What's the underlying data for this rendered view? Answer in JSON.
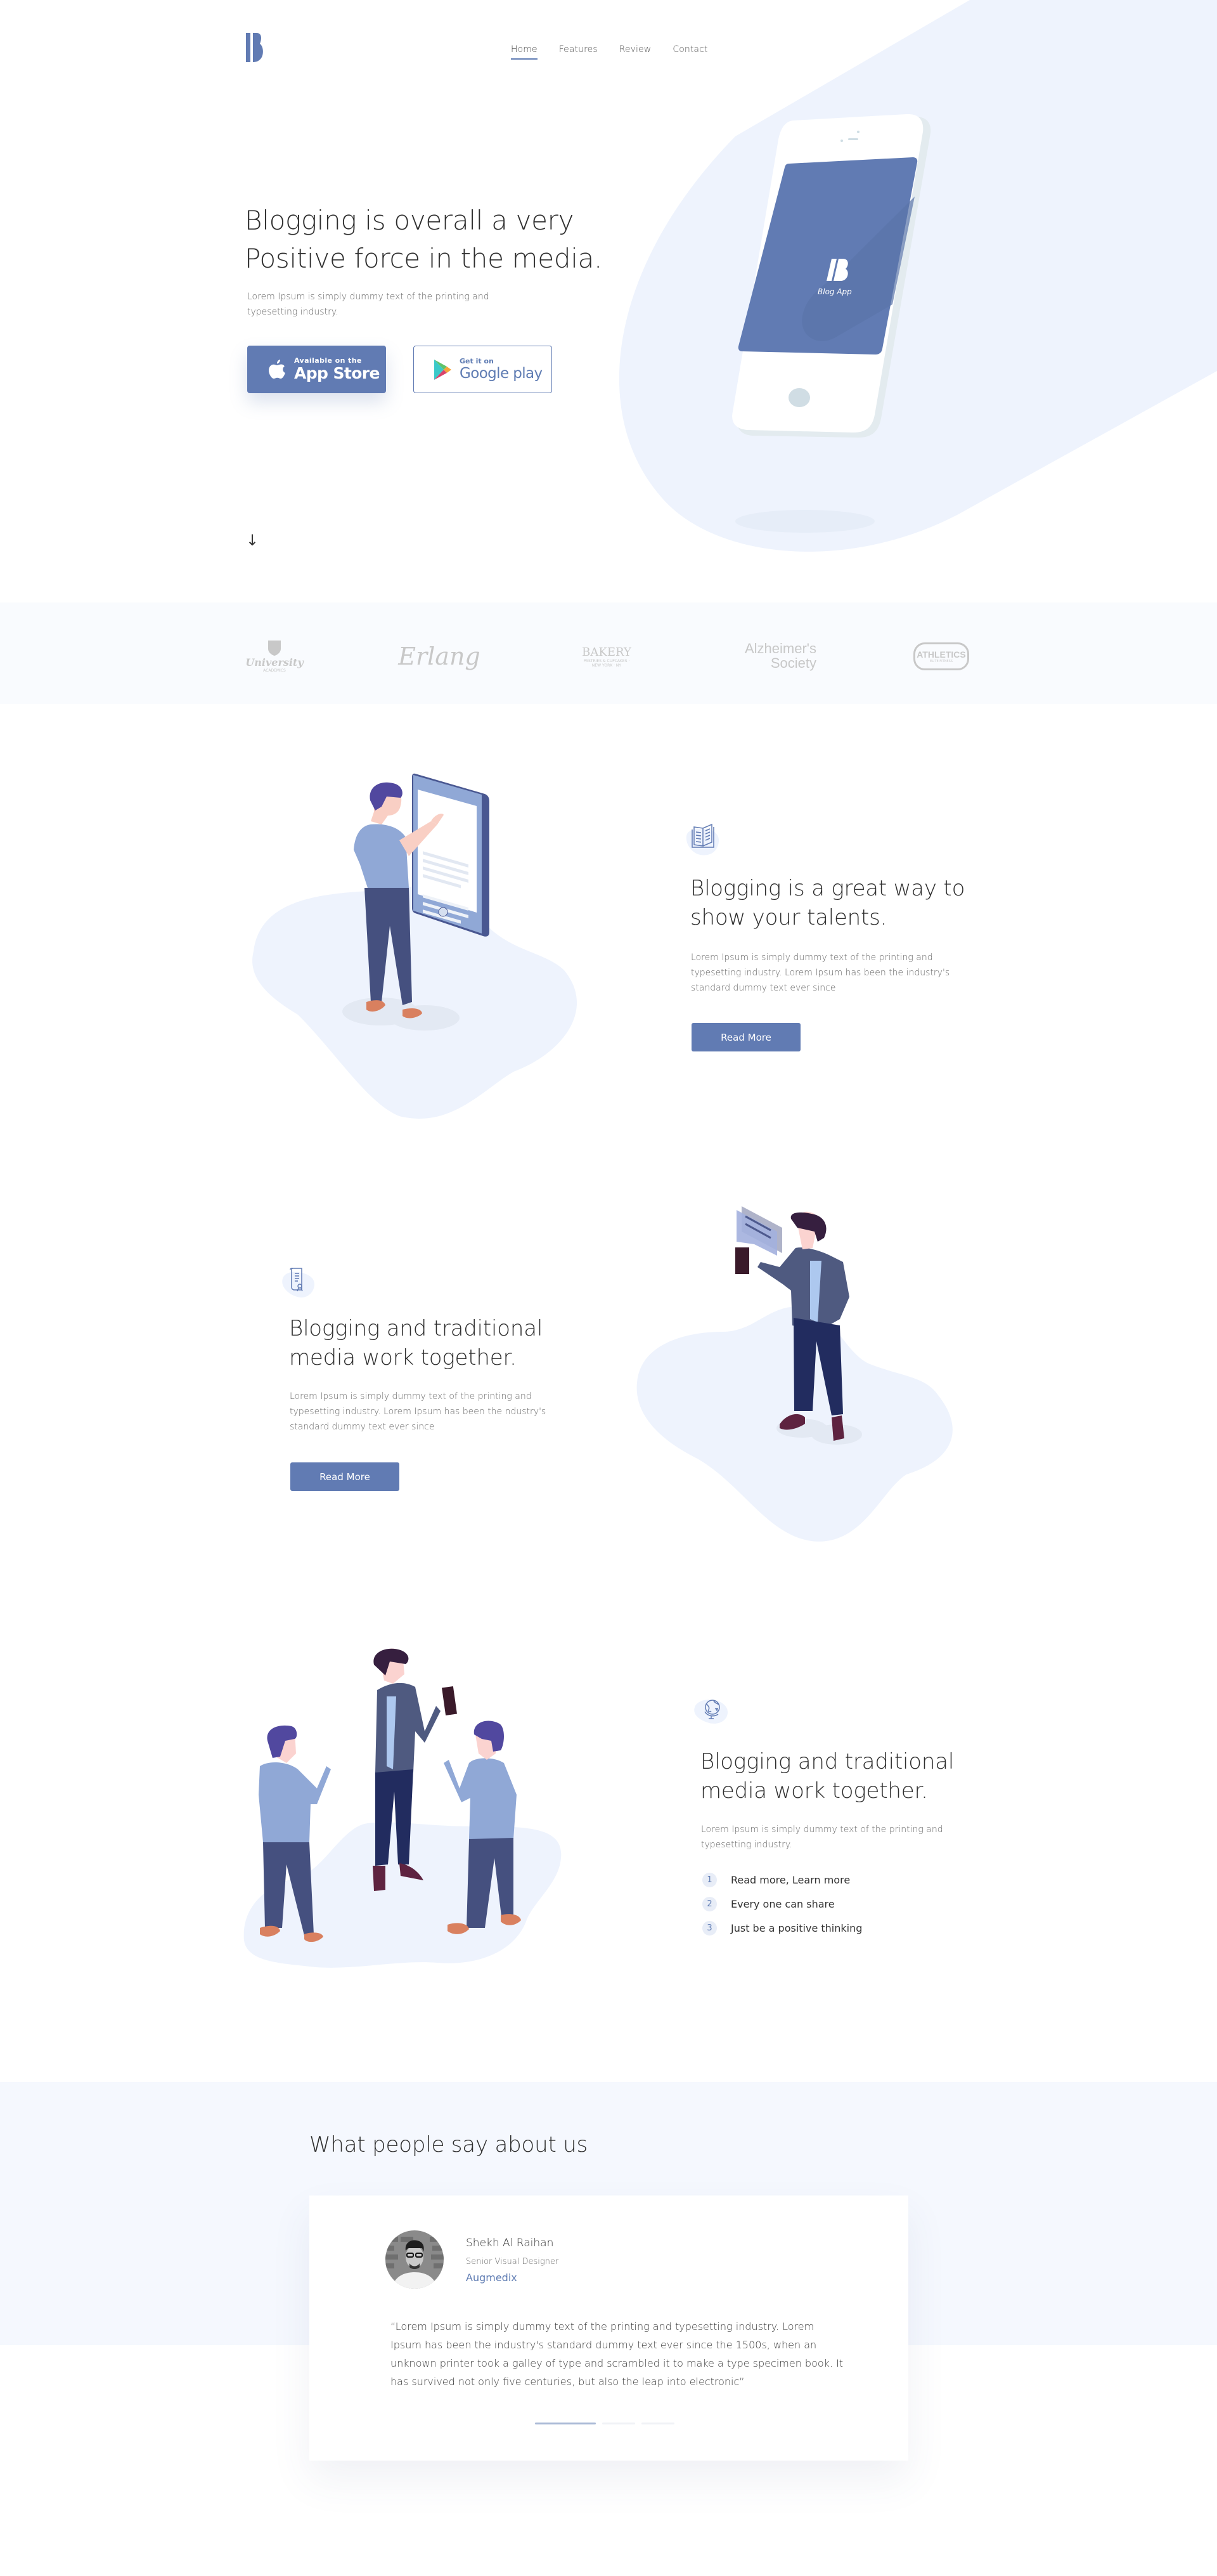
{
  "brand": {
    "logo_letter": "B",
    "accent": "#617bb3",
    "light_bg": "#eef3fd"
  },
  "nav": {
    "items": [
      {
        "label": "Home",
        "active": true
      },
      {
        "label": "Features",
        "active": false
      },
      {
        "label": "Review",
        "active": false
      },
      {
        "label": "Contact",
        "active": false
      }
    ]
  },
  "hero": {
    "title_line1": "Blogging is overall a very",
    "title_line2": "Positive force in the media.",
    "subtitle": "Lorem Ipsum is simply dummy text of the printing and typesetting industry.",
    "appstore": {
      "small": "Available on the",
      "big": "App Store",
      "icon": "apple-icon"
    },
    "googleplay": {
      "small": "Get it on",
      "big": "Google play",
      "icon": "google-play-icon"
    },
    "scroll_icon": "↓",
    "phone_app_name": "Blog App"
  },
  "clients": [
    {
      "name": "University",
      "sub": "ACADEMICS"
    },
    {
      "name": "Erlang",
      "sub": ""
    },
    {
      "name": "BAKERY",
      "sub": "PASTRIES & CUPCAKES · NEW YORK · NY"
    },
    {
      "name": "Alzheimer's",
      "sub": "Society"
    },
    {
      "name": "ATHLETICS",
      "sub": "ELITE FITNESS"
    }
  ],
  "features": [
    {
      "icon": "book-icon",
      "title_line1": "Blogging is a great way to",
      "title_line2": "show your talents.",
      "text": "Lorem Ipsum is simply dummy text of the printing and typesetting industry. Lorem Ipsum has been the industry's standard dummy text ever since",
      "button": "Read More"
    },
    {
      "icon": "certificate-icon",
      "title_line1": "Blogging and traditional",
      "title_line2": "media work together.",
      "text": "Lorem Ipsum is simply dummy text of the printing and typesetting industry. Lorem Ipsum has been the ndustry's standard dummy text ever since",
      "button": "Read More"
    },
    {
      "icon": "globe-icon",
      "title_line1": "Blogging and traditional",
      "title_line2": "media work together.",
      "text": "Lorem Ipsum is simply dummy text of the printing and typesetting industry.",
      "list": [
        {
          "num": "1",
          "label": "Read more, Learn more"
        },
        {
          "num": "2",
          "label": "Every one can share"
        },
        {
          "num": "3",
          "label": "Just be a positive thinking"
        }
      ]
    }
  ],
  "testimonials": {
    "title": "What people say about us",
    "current": {
      "name": "Shekh Al Raihan",
      "role": "Senior Visual Designer",
      "company": "Augmedix",
      "quote": "“Lorem Ipsum is simply dummy text of the printing and typesetting industry. Lorem Ipsum has been the industry's standard dummy text ever since the 1500s, when an unknown printer took a galley of type and scrambled it to make a type specimen book. It has survived not only five centuries, but also the leap into electronic”"
    },
    "slides_total": 3,
    "slide_active": 1
  }
}
